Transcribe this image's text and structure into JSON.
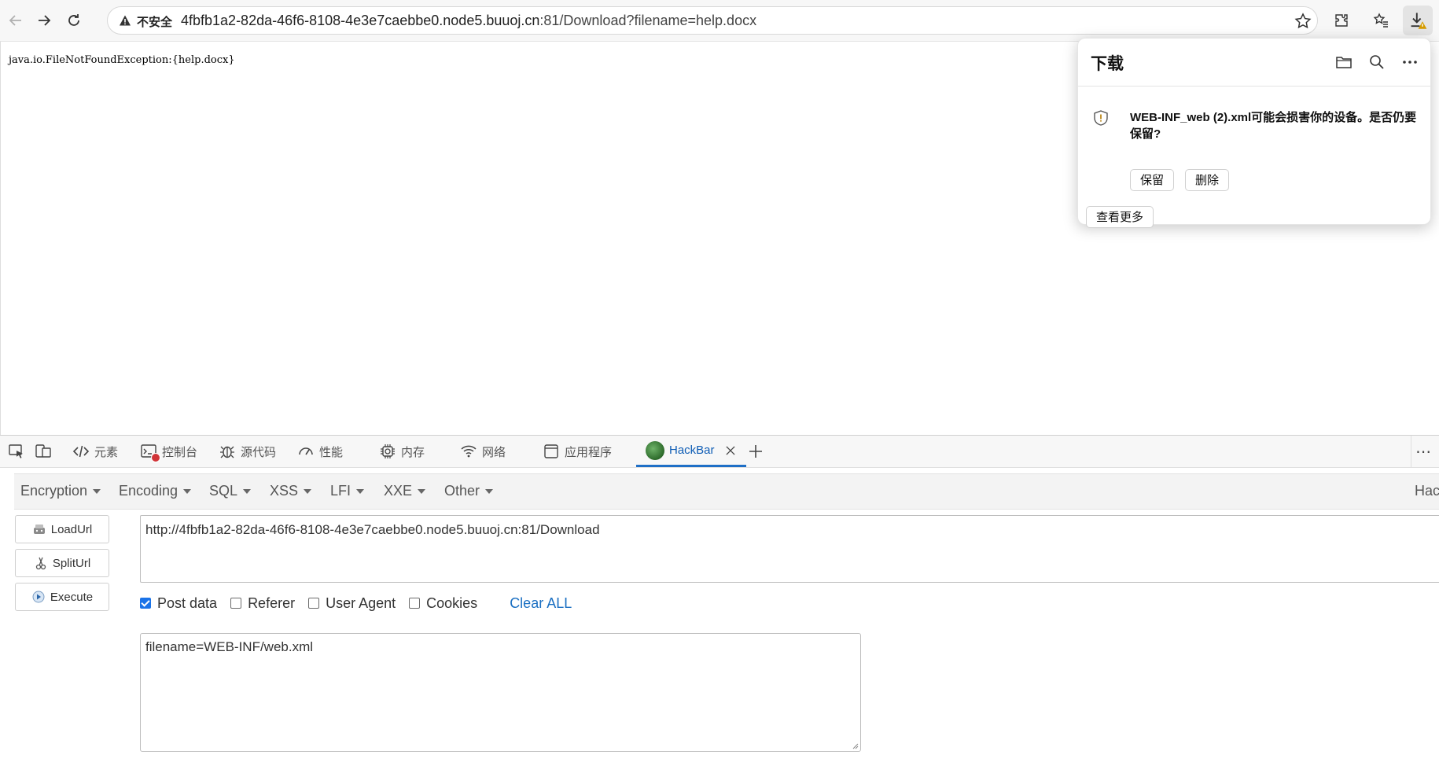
{
  "browser": {
    "security_label": "不安全",
    "url_host": "4fbfb1a2-82da-46f6-8108-4e3e7caebbe0.node5.buuoj.cn",
    "url_rest": ":81/Download?filename=help.docx"
  },
  "page": {
    "exception_text": "java.io.FileNotFoundException:{help.docx}"
  },
  "downloads": {
    "title": "下载",
    "warning_message": "WEB-INF_web (2).xml可能会损害你的设备。是否仍要保留?",
    "keep_label": "保留",
    "delete_label": "删除",
    "see_more_label": "查看更多"
  },
  "devtools": {
    "tabs": [
      {
        "label": "元素",
        "icon": "code-icon"
      },
      {
        "label": "控制台",
        "icon": "console-icon"
      },
      {
        "label": "源代码",
        "icon": "bug-icon"
      },
      {
        "label": "性能",
        "icon": "gauge-icon"
      },
      {
        "label": "内存",
        "icon": "chip-icon"
      },
      {
        "label": "网络",
        "icon": "wifi-icon"
      },
      {
        "label": "应用程序",
        "icon": "app-window-icon"
      },
      {
        "label": "HackBar",
        "icon": "hackbar-logo-icon",
        "active": true
      }
    ]
  },
  "hackbar": {
    "menu": [
      "Encryption",
      "Encoding",
      "SQL",
      "XSS",
      "LFI",
      "XXE",
      "Other"
    ],
    "menu_right": "Hac",
    "buttons": {
      "load_url": "LoadUrl",
      "split_url": "SplitUrl",
      "execute": "Execute"
    },
    "url_value": "http://4fbfb1a2-82da-46f6-8108-4e3e7caebbe0.node5.buuoj.cn:81/Download",
    "options": [
      {
        "label": "Post data",
        "checked": true
      },
      {
        "label": "Referer",
        "checked": false
      },
      {
        "label": "User Agent",
        "checked": false
      },
      {
        "label": "Cookies",
        "checked": false
      }
    ],
    "clear_all": "Clear ALL",
    "post_body": "filename=WEB-INF/web.xml"
  },
  "colors": {
    "accent": "#1f6fc6",
    "link": "#1a6fc2",
    "warning": "#b37a00"
  }
}
